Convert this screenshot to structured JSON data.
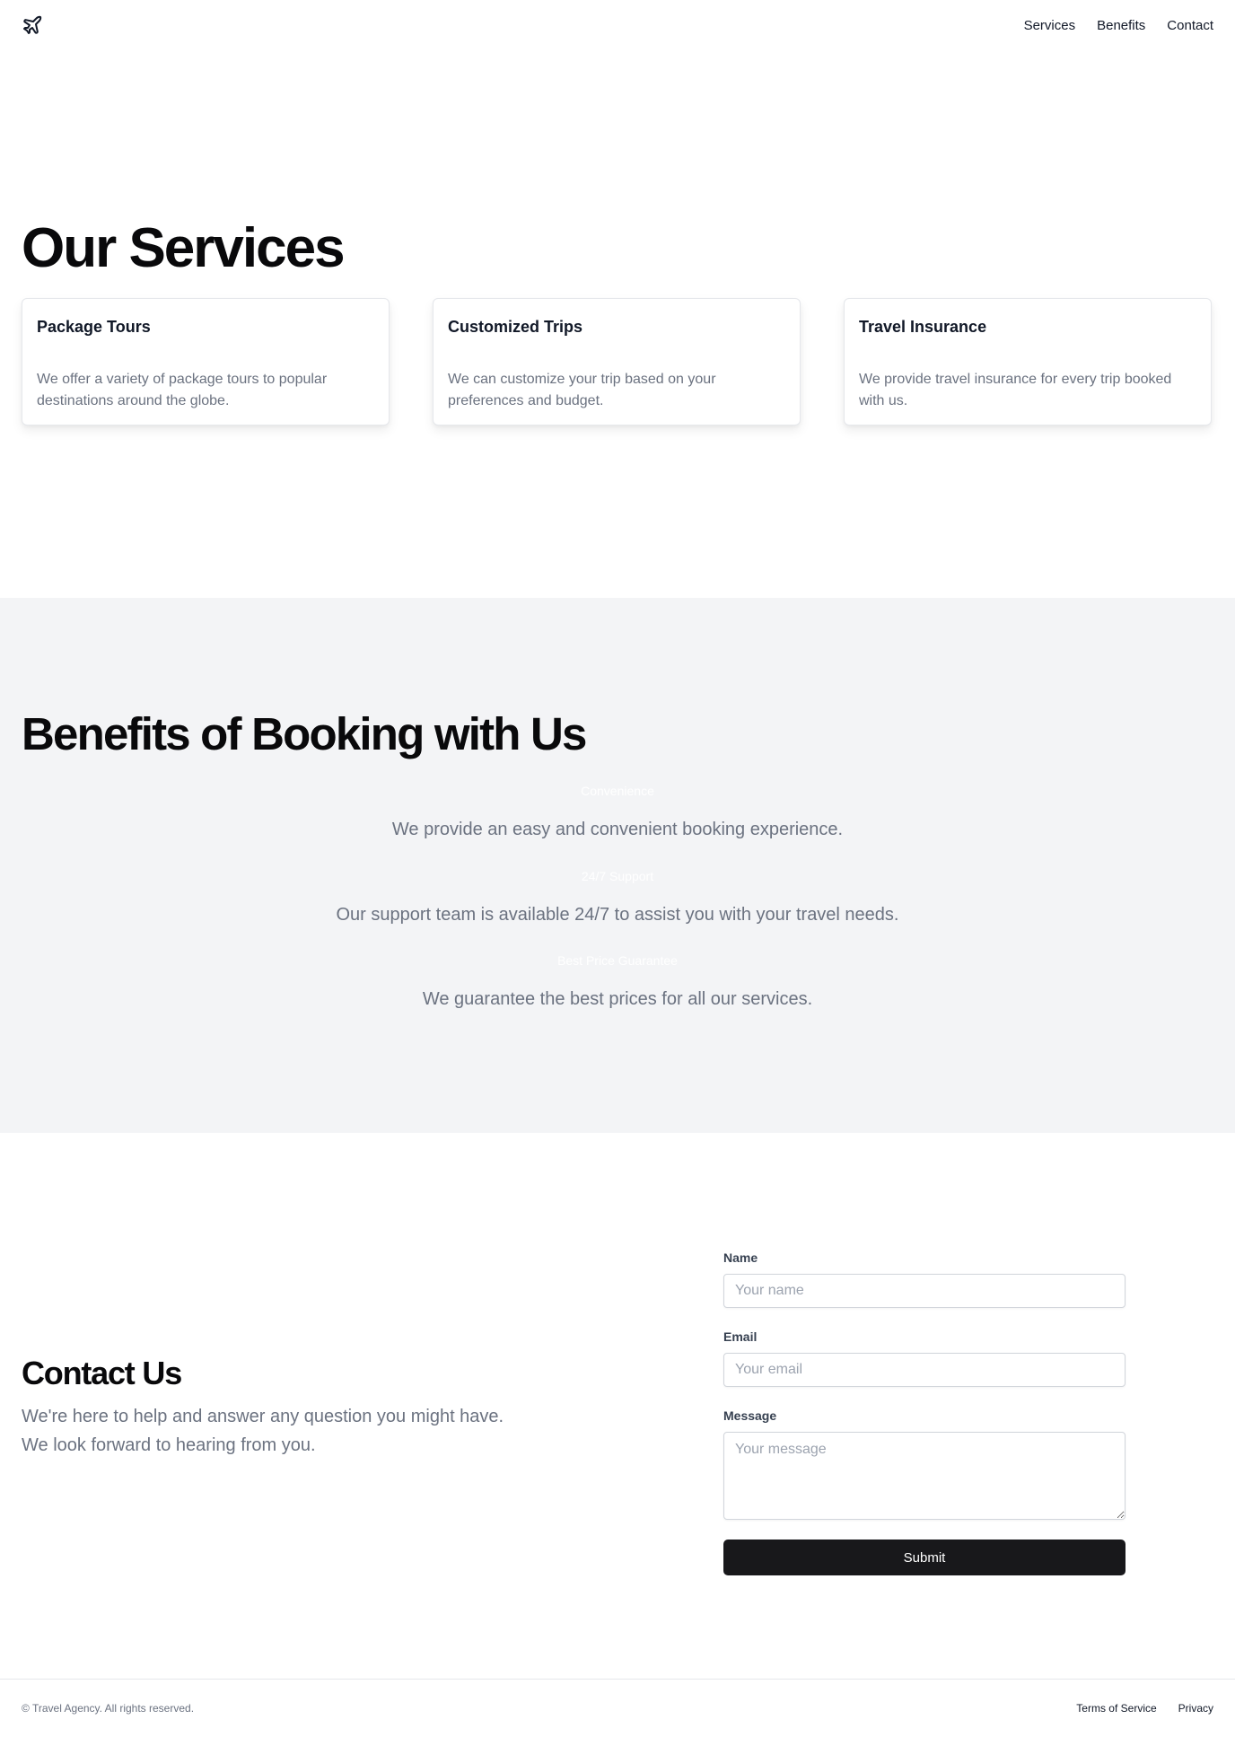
{
  "header": {
    "logo_icon": "airplane-icon",
    "nav": [
      {
        "label": "Services"
      },
      {
        "label": "Benefits"
      },
      {
        "label": "Contact"
      }
    ]
  },
  "services": {
    "title": "Our Services",
    "cards": [
      {
        "title": "Package Tours",
        "description": "We offer a variety of package tours to popular destinations around the globe."
      },
      {
        "title": "Customized Trips",
        "description": "We can customize your trip based on your preferences and budget."
      },
      {
        "title": "Travel Insurance",
        "description": "We provide travel insurance for every trip booked with us."
      }
    ]
  },
  "benefits": {
    "title": "Benefits of Booking with Us",
    "items": [
      {
        "title": "Convenience",
        "description": "We provide an easy and convenient booking experience."
      },
      {
        "title": "24/7 Support",
        "description": "Our support team is available 24/7 to assist you with your travel needs."
      },
      {
        "title": "Best Price Guarantee",
        "description": "We guarantee the best prices for all our services."
      }
    ]
  },
  "contact": {
    "title": "Contact Us",
    "line1": "We're here to help and answer any question you might have.",
    "line2": "We look forward to hearing from you.",
    "form": {
      "name_label": "Name",
      "name_placeholder": "Your name",
      "email_label": "Email",
      "email_placeholder": "Your email",
      "message_label": "Message",
      "message_placeholder": "Your message",
      "submit_label": "Submit"
    }
  },
  "footer": {
    "copyright": "© Travel Agency. All rights reserved.",
    "links": [
      {
        "label": "Terms of Service"
      },
      {
        "label": "Privacy"
      }
    ]
  },
  "colors": {
    "benefits_background": "#f3f4f6",
    "button_background": "#18181b",
    "muted_text": "#6b7280"
  }
}
